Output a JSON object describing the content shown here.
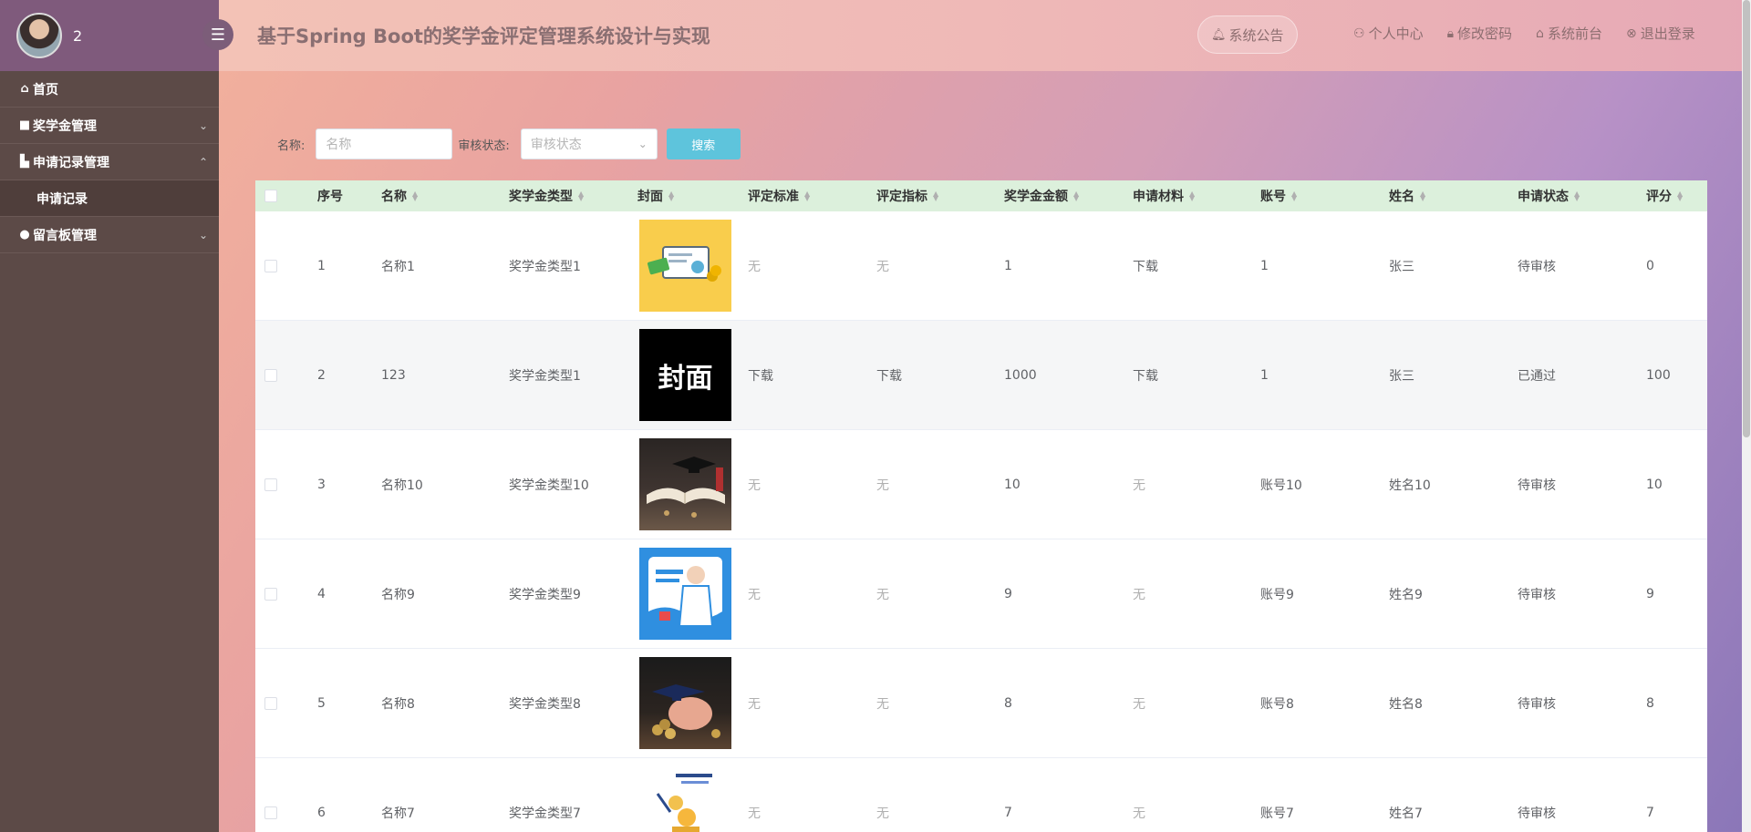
{
  "sidebar": {
    "username": "2",
    "menu": [
      {
        "label": "首页",
        "icon": "home-icon",
        "chevron": ""
      },
      {
        "label": "奖学金管理",
        "icon": "grid-icon",
        "chevron": "down"
      },
      {
        "label": "申请记录管理",
        "icon": "document-icon",
        "chevron": "up"
      },
      {
        "label": "申请记录",
        "sub": true
      },
      {
        "label": "留言板管理",
        "icon": "message-icon",
        "chevron": "down"
      }
    ]
  },
  "header": {
    "title": "基于Spring Boot的奖学金评定管理系统设计与实现",
    "notice": "系统公告",
    "links": [
      "个人中心",
      "修改密码",
      "系统前台",
      "退出登录"
    ]
  },
  "search": {
    "name_label": "名称:",
    "name_placeholder": "名称",
    "status_label": "审核状态:",
    "status_placeholder": "审核状态",
    "button": "搜索"
  },
  "table": {
    "columns": [
      "序号",
      "名称",
      "奖学金类型",
      "封面",
      "评定标准",
      "评定指标",
      "奖学金金额",
      "申请材料",
      "账号",
      "姓名",
      "申请状态",
      "评分"
    ],
    "rows": [
      {
        "no": "1",
        "name": "名称1",
        "type": "奖学金类型1",
        "cover": "certificate-money",
        "standard": "无",
        "index": "无",
        "amount": "1",
        "material": "下载",
        "account": "1",
        "realname": "张三",
        "status": "待审核",
        "score": "0"
      },
      {
        "no": "2",
        "name": "123",
        "type": "奖学金类型1",
        "cover": "cover-text",
        "cover_text": "封面",
        "standard": "下载",
        "index": "下载",
        "amount": "1000",
        "material": "下载",
        "account": "1",
        "realname": "张三",
        "status": "已通过",
        "score": "100"
      },
      {
        "no": "3",
        "name": "名称10",
        "type": "奖学金类型10",
        "cover": "book-cap",
        "standard": "无",
        "index": "无",
        "amount": "10",
        "material": "无",
        "account": "账号10",
        "realname": "姓名10",
        "status": "待审核",
        "score": "10"
      },
      {
        "no": "4",
        "name": "名称9",
        "type": "奖学金类型9",
        "cover": "health-poster",
        "standard": "无",
        "index": "无",
        "amount": "9",
        "material": "无",
        "account": "账号9",
        "realname": "姓名9",
        "status": "待审核",
        "score": "9"
      },
      {
        "no": "5",
        "name": "名称8",
        "type": "奖学金类型8",
        "cover": "piggy-bank",
        "standard": "无",
        "index": "无",
        "amount": "8",
        "material": "无",
        "account": "账号8",
        "realname": "姓名8",
        "status": "待审核",
        "score": "8"
      },
      {
        "no": "6",
        "name": "名称7",
        "type": "奖学金类型7",
        "cover": "coins-illustration",
        "standard": "无",
        "index": "无",
        "amount": "7",
        "material": "无",
        "account": "账号7",
        "realname": "姓名7",
        "status": "待审核",
        "score": "7"
      }
    ]
  }
}
